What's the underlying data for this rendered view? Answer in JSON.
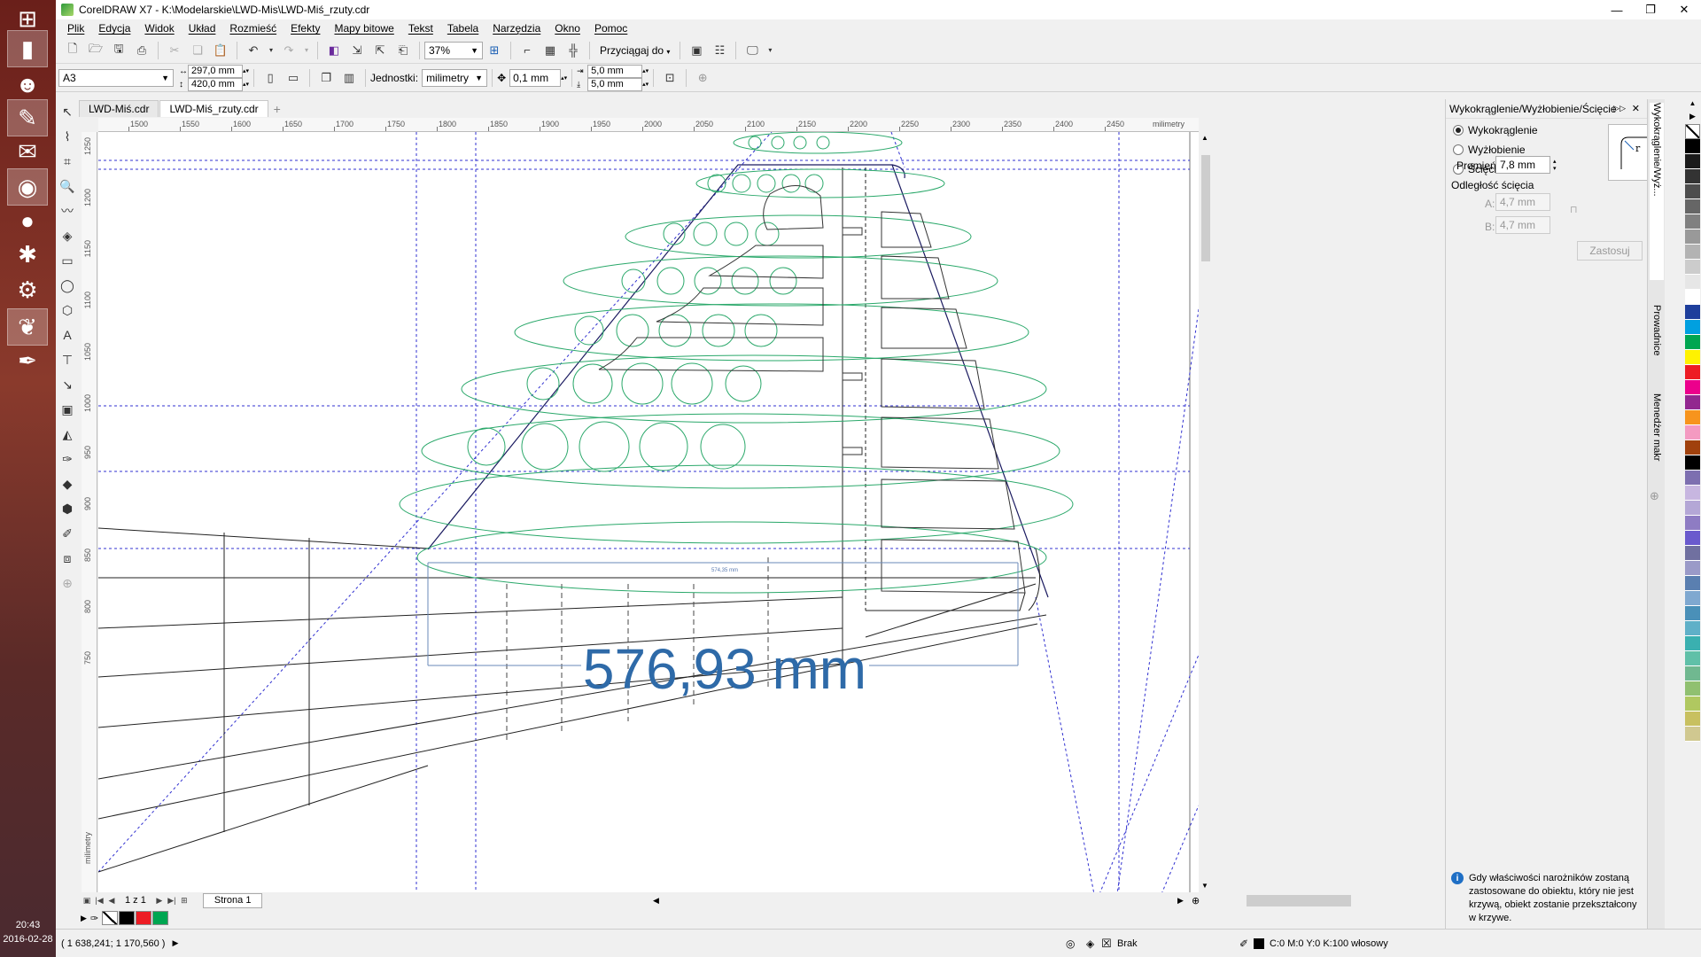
{
  "taskbar": {
    "icons": [
      "windows-start",
      "file-explorer",
      "smiley-app",
      "paint-app",
      "image-viewer",
      "chrome",
      "ball-app",
      "puzzle-app",
      "toolbox-app",
      "coreldraw",
      "ink-app"
    ],
    "clock_time": "20:43",
    "clock_date": "2016-02-28"
  },
  "window": {
    "title": "CorelDRAW X7 - K:\\Modelarskie\\LWD-Mis\\LWD-Miś_rzuty.cdr"
  },
  "menu": [
    "Plik",
    "Edycja",
    "Widok",
    "Układ",
    "Rozmieść",
    "Efekty",
    "Mapy bitowe",
    "Tekst",
    "Tabela",
    "Narzędzia",
    "Okno",
    "Pomoc"
  ],
  "toolbar": {
    "zoom": "37%",
    "snap_label": "Przyciągaj do"
  },
  "properties": {
    "page_size": "A3",
    "width": "297,0 mm",
    "height": "420,0 mm",
    "units_label": "Jednostki:",
    "units_value": "milimetry",
    "nudge": "0,1 mm",
    "dup_x": "5,0 mm",
    "dup_y": "5,0 mm"
  },
  "tabs": [
    {
      "label": "LWD-Miś.cdr",
      "active": false
    },
    {
      "label": "LWD-Miś_rzuty.cdr",
      "active": true
    }
  ],
  "ruler": {
    "h_labels": [
      "1500",
      "1550",
      "1600",
      "1650",
      "1700",
      "1750",
      "1800",
      "1850",
      "1900",
      "1950",
      "2000",
      "2050",
      "2100",
      "2150",
      "2200",
      "2250",
      "2300",
      "2350",
      "2400",
      "2450"
    ],
    "h_unit": "milimetry",
    "v_labels": [
      "1250",
      "1200",
      "1150",
      "1100",
      "1050",
      "1000",
      "950",
      "900",
      "850",
      "800",
      "750"
    ],
    "v_unit": "milimetry"
  },
  "drawing": {
    "dimension_text": "576,93 mm",
    "small_dim_text": "574,35 mm"
  },
  "page_nav": {
    "counter": "1 z 1",
    "page_tab": "Strona 1"
  },
  "status": {
    "coords": "( 1 638,241; 1 170,560 )",
    "fill_label": "Brak",
    "outline_label": "C:0 M:0 Y:0 K:100 włosowy"
  },
  "docker": {
    "title": "Wykokrąglenie/Wyżłobienie/Ścięcie",
    "options": [
      {
        "label": "Wykokrąglenie",
        "checked": true
      },
      {
        "label": "Wyżłobienie",
        "checked": false
      },
      {
        "label": "Ścięcie",
        "checked": false
      }
    ],
    "radius_label": "Promień:",
    "radius_value": "7,8 mm",
    "chamfer_label": "Odległość ścięcia",
    "a_label": "A:",
    "a_value": "4,7 mm",
    "b_label": "B:",
    "b_value": "4,7 mm",
    "apply_label": "Zastosuj",
    "info_text": "Gdy właściwości narożników zostaną zastosowane do obiektu, który nie jest krzywą, obiekt zostanie przekształcony w krzywe."
  },
  "side_tabs": [
    "Wykokrąglenie/Wyż...",
    "Prowadnice",
    "Menedżer makr"
  ],
  "palette_colors": [
    "#000000",
    "#1a1a1a",
    "#333333",
    "#4d4d4d",
    "#666666",
    "#808080",
    "#999999",
    "#b3b3b3",
    "#cccccc",
    "#e6e6e6",
    "#ffffff",
    "#1e3f9c",
    "#00a0e0",
    "#00a651",
    "#fff200",
    "#ed1c24",
    "#ec008c",
    "#92278f",
    "#f7941d",
    "#f49ac1",
    "#a0410d",
    "#000000",
    "#7d6fb0",
    "#c7b6e0",
    "#b4a7d6",
    "#8e7cc3",
    "#6a5acd",
    "#7070a0",
    "#9a9ac8",
    "#5a7fb0",
    "#7fa8d0",
    "#4a90b8",
    "#5fb0c8",
    "#3ab0b0",
    "#60c0a8",
    "#70b890",
    "#90c070",
    "#b0c860",
    "#c8c060",
    "#d0c890"
  ],
  "bottom_swatches": [
    "#ffffff",
    "#000000",
    "#ed1c24",
    "#00a651"
  ],
  "colors": {
    "green_lines": "#2aa86a",
    "guide_blue": "#3030d0",
    "dimension_blue": "#2e6aa8"
  }
}
